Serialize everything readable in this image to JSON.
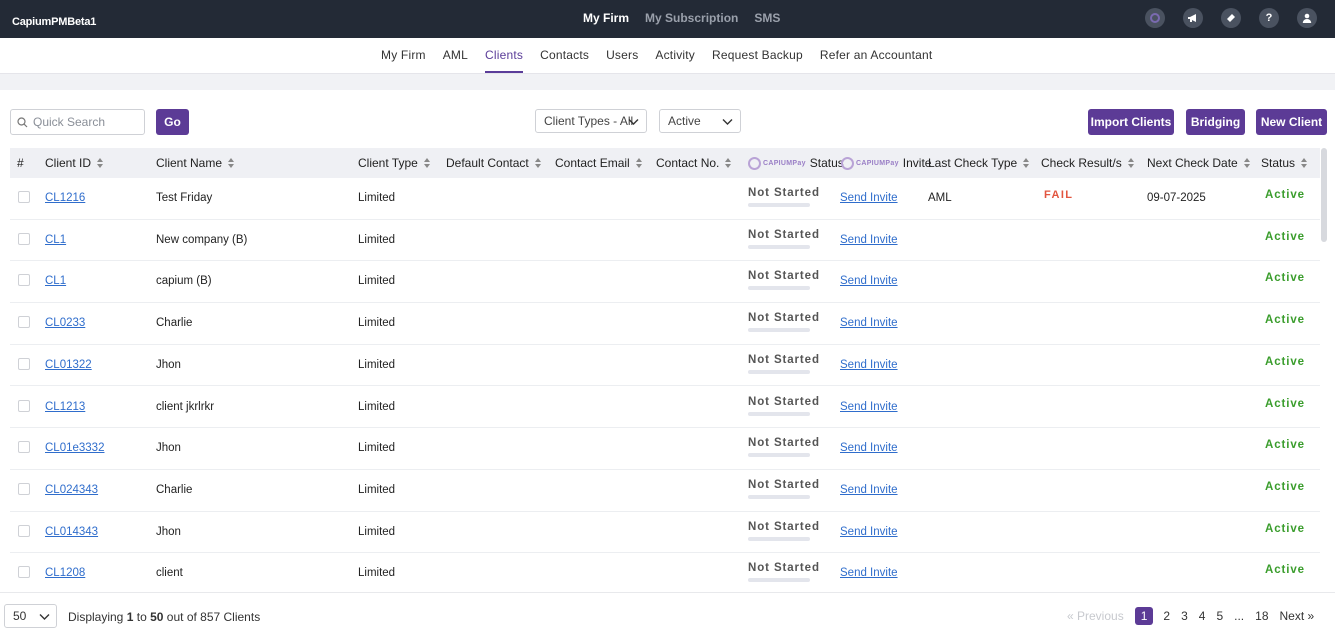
{
  "app": {
    "brand": "CapiumPMBeta1"
  },
  "topnav": [
    {
      "label": "My Firm",
      "active": true
    },
    {
      "label": "My Subscription",
      "active": false
    },
    {
      "label": "SMS",
      "active": false
    }
  ],
  "top_icons": [
    "capium-logo-icon",
    "megaphone-icon",
    "ticket-icon",
    "help-icon",
    "user-icon"
  ],
  "help_glyph": "?",
  "subnav": [
    {
      "label": "My Firm",
      "active": false
    },
    {
      "label": "AML",
      "active": false
    },
    {
      "label": "Clients",
      "active": true
    },
    {
      "label": "Contacts",
      "active": false
    },
    {
      "label": "Users",
      "active": false
    },
    {
      "label": "Activity",
      "active": false
    },
    {
      "label": "Request Backup",
      "active": false
    },
    {
      "label": "Refer an Accountant",
      "active": false
    }
  ],
  "toolbar": {
    "search_placeholder": "Quick Search",
    "search_value": "",
    "go_label": "Go",
    "client_types_select": "Client Types - All",
    "status_select": "Active",
    "import_label": "Import Clients",
    "bridging_label": "Bridging",
    "new_client_label": "New Client"
  },
  "table": {
    "columns": {
      "num": "#",
      "client_id": "Client ID",
      "client_name": "Client Name",
      "client_type": "Client Type",
      "default_contact": "Default Contact",
      "contact_email": "Contact Email",
      "contact_no": "Contact No.",
      "cp_status": "Status",
      "cp_invite": "Invite",
      "cp_logo_text": "CAPIUMPay",
      "last_check_type": "Last Check Type",
      "check_result": "Check Result/s",
      "next_check_date": "Next Check Date",
      "status": "Status"
    },
    "rows": [
      {
        "id": "CL1216",
        "name": "Test Friday",
        "type": "Limited",
        "cp_status": "Not Started",
        "invite": "Send Invite",
        "last_check": "AML",
        "result": "FAIL",
        "next_date": "09-07-2025",
        "status": "Active"
      },
      {
        "id": "CL1",
        "name": "New company (B)",
        "type": "Limited",
        "cp_status": "Not Started",
        "invite": "Send Invite",
        "last_check": "",
        "result": "",
        "next_date": "",
        "status": "Active"
      },
      {
        "id": "CL1",
        "name": "capium (B)",
        "type": "Limited",
        "cp_status": "Not Started",
        "invite": "Send Invite",
        "last_check": "",
        "result": "",
        "next_date": "",
        "status": "Active"
      },
      {
        "id": "CL0233",
        "name": "Charlie",
        "type": "Limited",
        "cp_status": "Not Started",
        "invite": "Send Invite",
        "last_check": "",
        "result": "",
        "next_date": "",
        "status": "Active"
      },
      {
        "id": "CL01322",
        "name": "Jhon",
        "type": "Limited",
        "cp_status": "Not Started",
        "invite": "Send Invite",
        "last_check": "",
        "result": "",
        "next_date": "",
        "status": "Active"
      },
      {
        "id": "CL1213",
        "name": "client jkrlrkr",
        "type": "Limited",
        "cp_status": "Not Started",
        "invite": "Send Invite",
        "last_check": "",
        "result": "",
        "next_date": "",
        "status": "Active"
      },
      {
        "id": "CL01e3332",
        "name": "Jhon",
        "type": "Limited",
        "cp_status": "Not Started",
        "invite": "Send Invite",
        "last_check": "",
        "result": "",
        "next_date": "",
        "status": "Active"
      },
      {
        "id": "CL024343",
        "name": "Charlie",
        "type": "Limited",
        "cp_status": "Not Started",
        "invite": "Send Invite",
        "last_check": "",
        "result": "",
        "next_date": "",
        "status": "Active"
      },
      {
        "id": "CL014343",
        "name": "Jhon",
        "type": "Limited",
        "cp_status": "Not Started",
        "invite": "Send Invite",
        "last_check": "",
        "result": "",
        "next_date": "",
        "status": "Active"
      },
      {
        "id": "CL1208",
        "name": "client",
        "type": "Limited",
        "cp_status": "Not Started",
        "invite": "Send Invite",
        "last_check": "",
        "result": "",
        "next_date": "",
        "status": "Active"
      }
    ]
  },
  "footer": {
    "page_size": "50",
    "display_prefix": "Displaying",
    "range_start": "1",
    "range_to": "to",
    "range_end": "50",
    "out_of": "out of 857 Clients",
    "prev_label": "« Previous",
    "pages": [
      "1",
      "2",
      "3",
      "4",
      "5",
      "...",
      "18"
    ],
    "current_page": "1",
    "next_label": "Next »"
  },
  "colors": {
    "topbar": "#232a36",
    "accent": "#5c3b96",
    "link": "#2f6dcc",
    "fail": "#e2553f",
    "active": "#3a9d2c"
  }
}
